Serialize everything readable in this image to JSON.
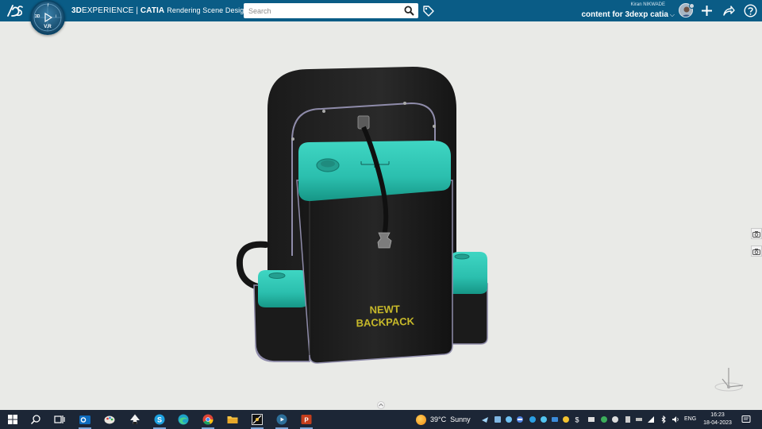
{
  "app": {
    "brand_part1": "3D",
    "brand_part2": "EXPERIENCE",
    "brand_separator": " | ",
    "brand_part3": "CATIA",
    "app_name": "Rendering Scene Design",
    "compass_version": "V.R",
    "compass_labels": [
      "3D",
      "i",
      "f",
      "⅔"
    ]
  },
  "search": {
    "placeholder": "Search",
    "value": ""
  },
  "user": {
    "name": "Kiran NIKWADE",
    "workspace": "content for 3dexp catia",
    "chevron": "⌵"
  },
  "top_icons": [
    "tag-icon",
    "avatar",
    "add-icon",
    "share-icon",
    "help-icon"
  ],
  "model": {
    "label_line1": "NEWT",
    "label_line2": "BACKPACK",
    "colors": {
      "body": "#1f1f1f",
      "lid": "#2bbfae",
      "label": "#c7b92a",
      "frame": "#9a98b2"
    }
  },
  "right_tools": [
    "capture-icon",
    "capture-icon"
  ],
  "taskbar": {
    "apps": [
      "windows-start-icon",
      "search-icon",
      "task-view-icon",
      "outlook-icon",
      "paint-icon",
      "inkscape-icon",
      "skype-icon",
      "edge-icon",
      "chrome-icon",
      "file-explorer-icon",
      "app-icon",
      "3dexperience-icon",
      "powerpoint-icon"
    ],
    "weather": {
      "temp": "39°C",
      "condition": "Sunny"
    },
    "language": "ENG",
    "time": "16:23",
    "date": "18-04-2023"
  },
  "colors": {
    "topbar": "#0a5c86",
    "viewport": "#e9eae7",
    "taskbar": "#1c2636"
  }
}
